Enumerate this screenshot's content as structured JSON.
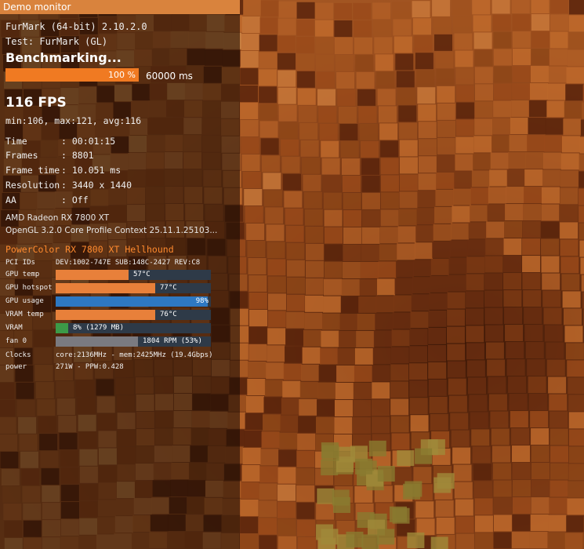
{
  "window": {
    "title": "Demo monitor"
  },
  "header": {
    "app_version": "FurMark (64-bit) 2.10.2.0",
    "test_name": "Test: FurMark (GL)",
    "status": "Benchmarking...",
    "progress_percent": 100,
    "progress_label": "100 %",
    "duration": "60000 ms"
  },
  "fps": {
    "current": "116 FPS",
    "stats": "min:106, max:121, avg:116"
  },
  "stats": {
    "time_label": "Time",
    "time_value": ": 00:01:15",
    "frames_label": "Frames",
    "frames_value": ": 8801",
    "frametime_label": "Frame time",
    "frametime_value": ": 10.051 ms",
    "resolution_label": "Resolution",
    "resolution_value": ": 3440 x 1440",
    "aa_label": "AA",
    "aa_value": ": Off"
  },
  "gpu_info": {
    "name": "AMD Radeon RX 7800 XT",
    "context": "OpenGL 3.2.0 Core Profile Context 25.11.1.25103..."
  },
  "sensors": {
    "card_name": "PowerColor RX 7800 XT Hellhound",
    "pci_label": "PCI IDs",
    "pci_value": "DEV:1002-747E SUB:148C-2427 REV:C8",
    "bars": [
      {
        "label": "GPU temp",
        "value_text": "57°C",
        "fraction": 0.47,
        "color": "#e8803a"
      },
      {
        "label": "GPU hotspot",
        "value_text": "77°C",
        "fraction": 0.64,
        "color": "#e8803a"
      },
      {
        "label": "GPU usage",
        "value_text": "98%",
        "fraction": 0.98,
        "color": "#2e78c2"
      },
      {
        "label": "VRAM temp",
        "value_text": "76°C",
        "fraction": 0.64,
        "color": "#e8803a"
      },
      {
        "label": "VRAM",
        "value_text": "8% (1279 MB)",
        "fraction": 0.08,
        "color": "#3c9a48"
      },
      {
        "label": "fan 0",
        "value_text": "1804 RPM (53%)",
        "fraction": 0.53,
        "color": "#7a7a80"
      }
    ],
    "clocks_label": "Clocks",
    "clocks_value": "core:2136MHz - mem:2425MHz (19.4Gbps)",
    "power_label": "power",
    "power_value": "271W - PPW:0.428"
  },
  "colors": {
    "titlebar": "#d9833d",
    "accent_orange": "#f07a22",
    "card_name": "#ff8a2e"
  }
}
